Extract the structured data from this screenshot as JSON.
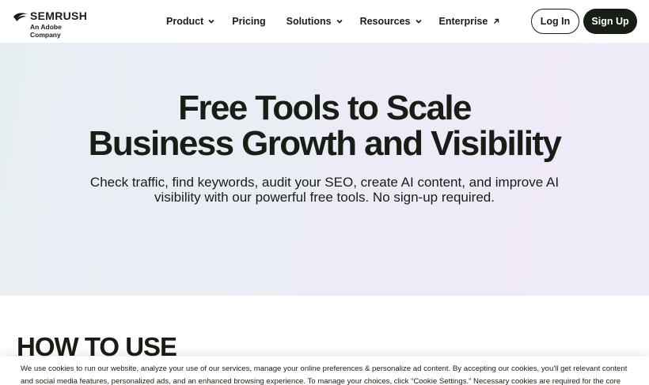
{
  "header": {
    "logo": {
      "brand": "SEMRUSH",
      "tagline": "An Adobe Company"
    },
    "nav": [
      {
        "label": "Product",
        "icon": "chevron-down-icon"
      },
      {
        "label": "Pricing"
      },
      {
        "label": "Solutions",
        "icon": "chevron-down-icon"
      },
      {
        "label": "Resources",
        "icon": "chevron-down-icon"
      },
      {
        "label": "Enterprise",
        "icon": "external-arrow-icon"
      }
    ],
    "login_label": "Log In",
    "signup_label": "Sign Up"
  },
  "hero": {
    "title_line1": "Free Tools to Scale",
    "title_line2": "Business Growth and Visibility",
    "subtitle": "Check traffic, find keywords, audit your SEO, create AI content, and improve AI visibility with our powerful free tools. No sign-up required."
  },
  "section": {
    "heading": "HOW TO USE"
  },
  "cookie": {
    "text": "We use cookies to run our website, analyze your use of our services, manage your online preferences & personalize ad content. By accepting our cookies, you'll get relevant content and social media features, personalized ads, and an enhanced browsing experience. To manage your choices, click “Cookie Settings.” Necessary cookies are required for the core"
  },
  "colors": {
    "text": "#181e15",
    "button_dark": "#181e15",
    "hero_gradient_start": "#e7eef2",
    "hero_gradient_end": "#f1ecfa"
  }
}
